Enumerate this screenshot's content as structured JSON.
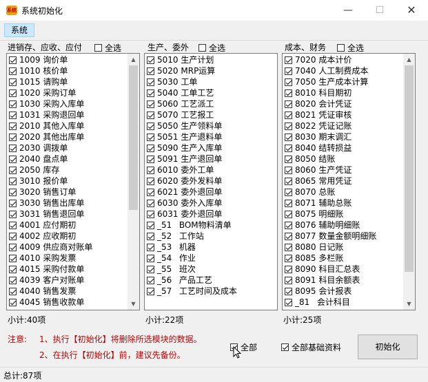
{
  "window": {
    "title": "系统初始化",
    "app_icon_text": "系统",
    "minimize_glyph": "—",
    "maximize_glyph": "☐",
    "close_glyph": "✕"
  },
  "toolbar": {
    "system_label": "系统"
  },
  "panels": [
    {
      "title": "进销存、应收、应付",
      "select_all_label": "全选",
      "select_all_checked": false,
      "subtotal": "小计:40项",
      "items": [
        {
          "code": "1009",
          "label": "询价单",
          "checked": true
        },
        {
          "code": "1010",
          "label": "核价单",
          "checked": true
        },
        {
          "code": "1015",
          "label": "请购单",
          "checked": true
        },
        {
          "code": "1020",
          "label": "采购订单",
          "checked": true
        },
        {
          "code": "1030",
          "label": "采购入库单",
          "checked": true
        },
        {
          "code": "1031",
          "label": "采购退回单",
          "checked": true
        },
        {
          "code": "2010",
          "label": "其他入库单",
          "checked": true
        },
        {
          "code": "2020",
          "label": "其他出库单",
          "checked": true
        },
        {
          "code": "2030",
          "label": "调拨单",
          "checked": true
        },
        {
          "code": "2040",
          "label": "盘点单",
          "checked": true
        },
        {
          "code": "2050",
          "label": "库存",
          "checked": true
        },
        {
          "code": "3010",
          "label": "报价单",
          "checked": true
        },
        {
          "code": "3020",
          "label": "销售订单",
          "checked": true
        },
        {
          "code": "3030",
          "label": "销售出库单",
          "checked": true
        },
        {
          "code": "3031",
          "label": "销售退回单",
          "checked": true
        },
        {
          "code": "4001",
          "label": "应付期初",
          "checked": true
        },
        {
          "code": "4002",
          "label": "应收期初",
          "checked": true
        },
        {
          "code": "4009",
          "label": "供应商对账单",
          "checked": true
        },
        {
          "code": "4010",
          "label": "采购发票",
          "checked": true
        },
        {
          "code": "4015",
          "label": "采购付款单",
          "checked": true
        },
        {
          "code": "4039",
          "label": "客户对账单",
          "checked": true
        },
        {
          "code": "4040",
          "label": "销售发票",
          "checked": true
        },
        {
          "code": "4045",
          "label": "销售收款单",
          "checked": true
        }
      ]
    },
    {
      "title": "生产、委外",
      "select_all_label": "全选",
      "select_all_checked": false,
      "subtotal": "小计:22项",
      "items": [
        {
          "code": "5010",
          "label": "生产计划",
          "checked": true
        },
        {
          "code": "5020",
          "label": "MRP运算",
          "checked": true
        },
        {
          "code": "5030",
          "label": "工单",
          "checked": true
        },
        {
          "code": "5040",
          "label": "工单工艺",
          "checked": true
        },
        {
          "code": "5060",
          "label": "工艺派工",
          "checked": true
        },
        {
          "code": "5070",
          "label": "工艺报工",
          "checked": true
        },
        {
          "code": "5050",
          "label": "生产领料单",
          "checked": true
        },
        {
          "code": "5051",
          "label": "生产退料单",
          "checked": true
        },
        {
          "code": "5090",
          "label": "生产入库单",
          "checked": true
        },
        {
          "code": "5091",
          "label": "生产退回单",
          "checked": true
        },
        {
          "code": "6010",
          "label": "委外工单",
          "checked": true
        },
        {
          "code": "6020",
          "label": "委外发料单",
          "checked": true
        },
        {
          "code": "6021",
          "label": "委外退回单",
          "checked": true
        },
        {
          "code": "6030",
          "label": "委外入库单",
          "checked": true
        },
        {
          "code": "6031",
          "label": "委外退回单",
          "checked": true
        },
        {
          "code": "_51",
          "label": "BOM物料清单",
          "checked": true
        },
        {
          "code": "_52",
          "label": "工作站",
          "checked": true
        },
        {
          "code": "_53",
          "label": "机器",
          "checked": true
        },
        {
          "code": "_54",
          "label": "作业",
          "checked": true
        },
        {
          "code": "_55",
          "label": "班次",
          "checked": true
        },
        {
          "code": "_56",
          "label": "产品工艺",
          "checked": true
        },
        {
          "code": "_57",
          "label": "工艺时间及成本",
          "checked": true
        }
      ]
    },
    {
      "title": "成本、财务",
      "select_all_label": "全选",
      "select_all_checked": false,
      "subtotal": "小计:25项",
      "items": [
        {
          "code": "7020",
          "label": "成本计价",
          "checked": true
        },
        {
          "code": "7040",
          "label": "人工制费成本",
          "checked": true
        },
        {
          "code": "7050",
          "label": "生产成本计算",
          "checked": true
        },
        {
          "code": "8010",
          "label": "科目期初",
          "checked": true
        },
        {
          "code": "8020",
          "label": "会计凭证",
          "checked": true
        },
        {
          "code": "8021",
          "label": "凭证审核",
          "checked": true
        },
        {
          "code": "8022",
          "label": "凭证记账",
          "checked": true
        },
        {
          "code": "8030",
          "label": "期末调汇",
          "checked": true
        },
        {
          "code": "8040",
          "label": "结转损益",
          "checked": true
        },
        {
          "code": "8050",
          "label": "结账",
          "checked": true
        },
        {
          "code": "8060",
          "label": "生产凭证",
          "checked": true
        },
        {
          "code": "8065",
          "label": "常用凭证",
          "checked": true
        },
        {
          "code": "8070",
          "label": "总账",
          "checked": true
        },
        {
          "code": "8071",
          "label": "辅助总账",
          "checked": true
        },
        {
          "code": "8075",
          "label": "明细账",
          "checked": true
        },
        {
          "code": "8076",
          "label": "辅助明细账",
          "checked": true
        },
        {
          "code": "8077",
          "label": "数量金额明细账",
          "checked": true
        },
        {
          "code": "8080",
          "label": "日记账",
          "checked": true
        },
        {
          "code": "8085",
          "label": "多栏账",
          "checked": true
        },
        {
          "code": "8090",
          "label": "科目汇总表",
          "checked": true
        },
        {
          "code": "8091",
          "label": "科目余额表",
          "checked": true
        },
        {
          "code": "8095",
          "label": "会计报表",
          "checked": true
        },
        {
          "code": "_81",
          "label": "会计科目",
          "checked": true
        }
      ]
    }
  ],
  "notice": {
    "prefix": "注意:",
    "line1": "1、执行【初始化】将删除所选模块的数据。",
    "line2": "2、在执行【初始化】前，建议先备份。",
    "color": "#c00000"
  },
  "options": {
    "all_label": "全部",
    "all_checked": true,
    "base_data_label": "全部基础资料",
    "base_data_checked": true
  },
  "init_button_label": "初始化",
  "status": {
    "total": "总计:87项"
  },
  "colors": {
    "toolbar_button_bg": "#cce8ff",
    "window_bg": "#f0f0f0",
    "scroll_thumb": "#cdcdcd"
  }
}
